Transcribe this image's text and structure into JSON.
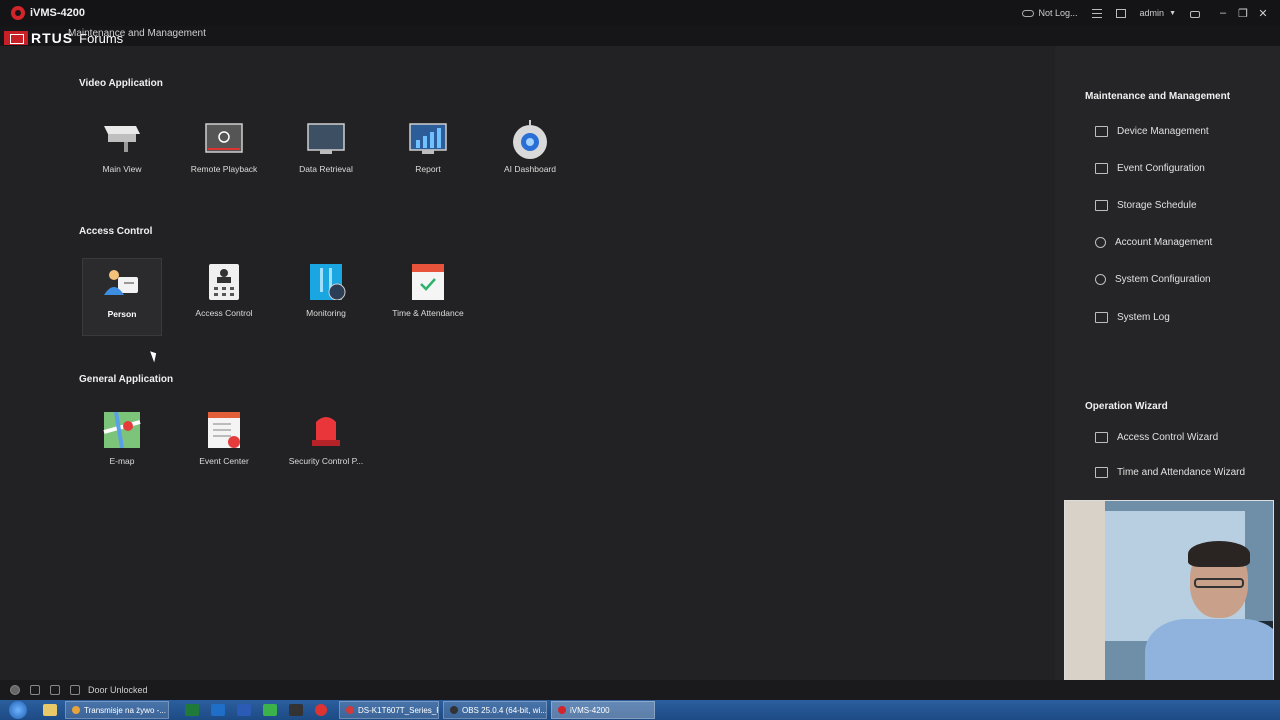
{
  "window": {
    "title": "iVMS-4200",
    "not_logged": "Not Log...",
    "user": "admin"
  },
  "overlay": {
    "brand_text": "RTUS",
    "brand_sub": "Forums",
    "breadcrumb": "Maintenance and Management"
  },
  "main": {
    "sections": [
      {
        "title": "Video Application",
        "tiles": [
          {
            "label": "Main View",
            "icon": "camera-icon"
          },
          {
            "label": "Remote Playback",
            "icon": "playback-icon"
          },
          {
            "label": "Data Retrieval",
            "icon": "monitor-icon"
          },
          {
            "label": "Report",
            "icon": "report-chart-icon"
          },
          {
            "label": "AI Dashboard",
            "icon": "ai-robot-icon"
          }
        ]
      },
      {
        "title": "Access Control",
        "tiles": [
          {
            "label": "Person",
            "icon": "person-card-icon"
          },
          {
            "label": "Access Control",
            "icon": "access-terminal-icon"
          },
          {
            "label": "Monitoring",
            "icon": "door-monitor-icon"
          },
          {
            "label": "Time & Attendance",
            "icon": "calendar-icon"
          }
        ]
      },
      {
        "title": "General Application",
        "tiles": [
          {
            "label": "E-map",
            "icon": "map-icon"
          },
          {
            "label": "Event Center",
            "icon": "event-list-icon"
          },
          {
            "label": "Security Control P...",
            "icon": "alarm-light-icon"
          }
        ]
      }
    ]
  },
  "right_panel": {
    "maintenance_title": "Maintenance and Management",
    "maintenance_items": [
      {
        "label": "Device Management",
        "icon": "device-icon"
      },
      {
        "label": "Event Configuration",
        "icon": "event-config-icon"
      },
      {
        "label": "Storage Schedule",
        "icon": "storage-icon"
      },
      {
        "label": "Account Management",
        "icon": "account-icon"
      },
      {
        "label": "System Configuration",
        "icon": "gear-icon"
      },
      {
        "label": "System Log",
        "icon": "log-icon"
      }
    ],
    "wizard_title": "Operation Wizard",
    "wizard_items": [
      {
        "label": "Access Control Wizard",
        "icon": "wizard-icon"
      },
      {
        "label": "Time and Attendance Wizard",
        "icon": "calendar-icon"
      }
    ]
  },
  "status_bar": {
    "text": "Door Unlocked"
  },
  "taskbar": {
    "tasks": [
      {
        "label": "Transmisje na żywo -...",
        "color": "#e8a33a"
      },
      {
        "label": "DS-K1T607T_Series_F...",
        "color": "#d23a3a"
      },
      {
        "label": "OBS 25.0.4 (64-bit, wi...",
        "color": "#333333"
      },
      {
        "label": "iVMS-4200",
        "color": "#d3242a"
      }
    ]
  }
}
